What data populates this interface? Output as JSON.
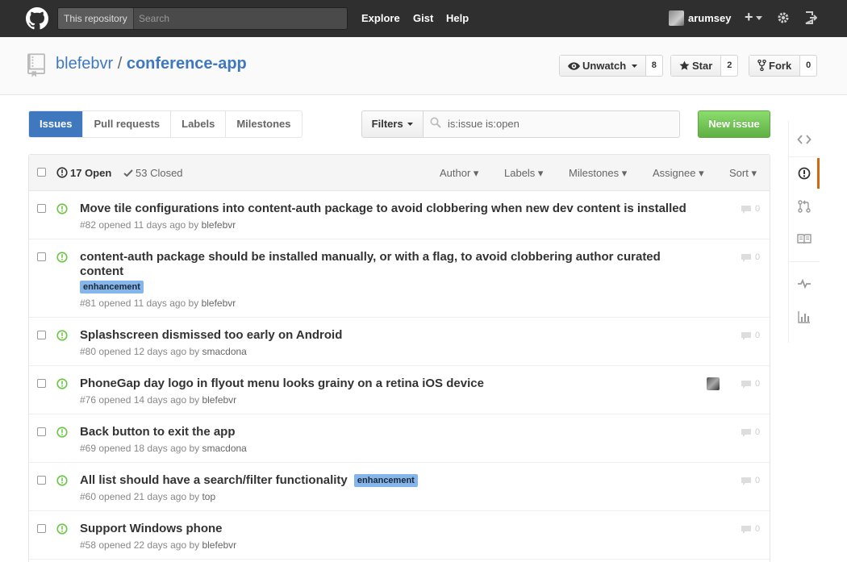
{
  "header": {
    "search_scope": "This repository",
    "search_placeholder": "Search",
    "nav": [
      "Explore",
      "Gist",
      "Help"
    ],
    "username": "arumsey",
    "plus_label": "+"
  },
  "repo": {
    "owner": "blefebvr",
    "separator": "/",
    "name": "conference-app",
    "unwatch_label": "Unwatch",
    "watch_count": "8",
    "star_label": "Star",
    "star_count": "2",
    "fork_label": "Fork",
    "fork_count": "0"
  },
  "subnav": {
    "items": [
      "Issues",
      "Pull requests",
      "Labels",
      "Milestones"
    ],
    "selected": "Issues"
  },
  "filters": {
    "button_label": "Filters",
    "query": "is:issue is:open"
  },
  "new_issue_label": "New issue",
  "issues_header": {
    "open_label": "17 Open",
    "closed_label": "53 Closed",
    "sorts": [
      "Author",
      "Labels",
      "Milestones",
      "Assignee",
      "Sort"
    ]
  },
  "issues": [
    {
      "title": "Move tile configurations into content-auth package to avoid clobbering when new dev content is installed",
      "meta": "#82 opened 11 days ago by ",
      "author": "blefebvr",
      "comments": "0"
    },
    {
      "title": "content-auth package should be installed manually, or with a flag, to avoid clobbering author curated content",
      "label": "enhancement",
      "meta": "#81 opened 11 days ago by ",
      "author": "blefebvr",
      "comments": "0"
    },
    {
      "title": "Splashscreen dismissed too early on Android",
      "meta": "#80 opened 12 days ago by ",
      "author": "smacdona",
      "comments": "0"
    },
    {
      "title": "PhoneGap day logo in flyout menu looks grainy on a retina iOS device",
      "meta": "#76 opened 14 days ago by ",
      "author": "blefebvr",
      "comments": "0"
    },
    {
      "title": "Back button to exit the app",
      "meta": "#69 opened 18 days ago by ",
      "author": "smacdona",
      "comments": "0"
    },
    {
      "title": "All list should have a search/filter functionality",
      "label": "enhancement",
      "meta": "#60 opened 21 days ago by ",
      "author": "top",
      "comments": "0"
    },
    {
      "title": "Support Windows phone",
      "meta": "#58 opened 22 days ago by ",
      "author": "blefebvr",
      "comments": "0"
    }
  ],
  "colors": {
    "accent": "#4078c0",
    "open_green": "#6cc644",
    "label_blue": "#84b6eb",
    "new_issue_green": "#60b044",
    "sidenav_active": "#d26911"
  }
}
